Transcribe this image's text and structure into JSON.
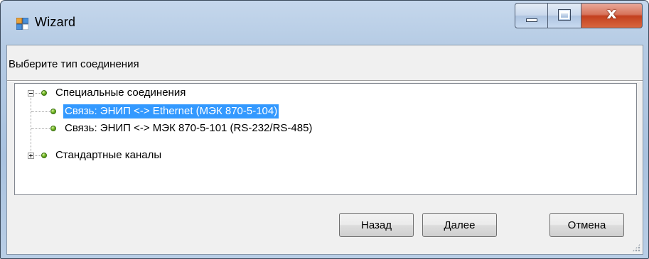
{
  "window": {
    "title": "Wizard",
    "icon": "wizard-app-icon",
    "caption_buttons": [
      "minimize",
      "maximize",
      "close"
    ],
    "close_glyph": "x"
  },
  "prompt": "Выберите тип соединения",
  "tree": {
    "nodes": [
      {
        "label": "Специальные соединения",
        "expanded": true,
        "children": [
          {
            "label": "Связь: ЭНИП <-> Ethernet (МЭК 870-5-104)",
            "selected": true
          },
          {
            "label": "Связь: ЭНИП <-> МЭК 870-5-101 (RS-232/RS-485)",
            "selected": false
          }
        ]
      },
      {
        "label": "Стандартные каналы",
        "expanded": false,
        "children": []
      }
    ]
  },
  "buttons": {
    "back": "Назад",
    "next": "Далее",
    "cancel": "Отмена"
  },
  "colors": {
    "selection": "#3399ff",
    "node_dot": "#74b724",
    "close_button": "#c3401f"
  }
}
